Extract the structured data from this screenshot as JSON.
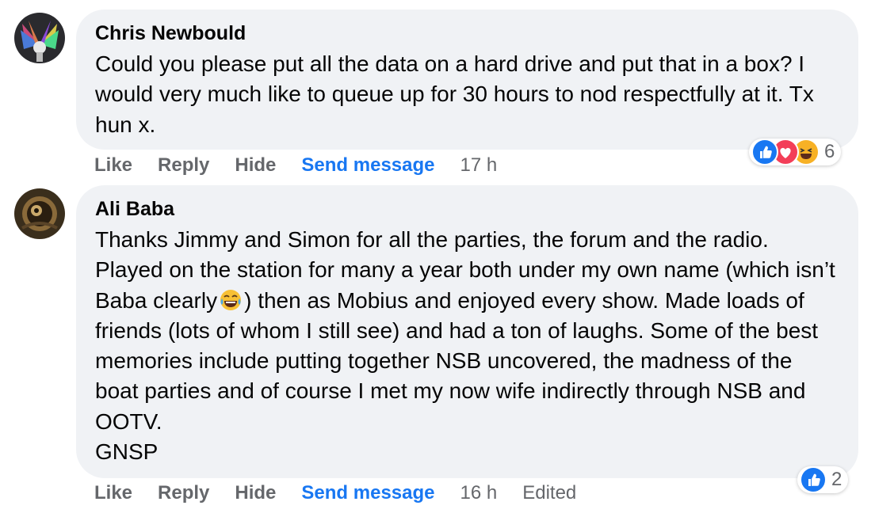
{
  "comments": [
    {
      "author": "Chris Newbould",
      "text": "Could you please put all the data on a hard drive and put that in a box? I would very much like to queue up for 30 hours to nod respectfully at it. Tx hun x.",
      "actions": {
        "like": "Like",
        "reply": "Reply",
        "hide": "Hide",
        "send_message": "Send message",
        "time": "17 h"
      },
      "reactions": {
        "icons": [
          "like-icon",
          "love-icon",
          "haha-icon"
        ],
        "count": "6"
      }
    },
    {
      "author": "Ali Baba",
      "text_before_emoji": "Thanks Jimmy and Simon for all the parties, the forum and the radio. Played on the station for many a year both under my own name (which isn’t Baba clearly",
      "emoji": "tears-of-joy-emoji",
      "text_after_emoji": ") then as Mobius and enjoyed every show. Made loads of friends (lots of whom I still see) and had a ton of laughs. Some of the best memories include putting together NSB uncovered, the madness of the boat parties and of course I met my now wife indirectly through NSB and OOTV.",
      "signoff": "GNSP",
      "actions": {
        "like": "Like",
        "reply": "Reply",
        "hide": "Hide",
        "send_message": "Send message",
        "time": "16 h",
        "edited": "Edited"
      },
      "reactions": {
        "icons": [
          "like-icon"
        ],
        "count": "2"
      }
    }
  ],
  "colors": {
    "bubble": "#f0f2f5",
    "link_blue": "#1877f2",
    "meta_gray": "#65676b",
    "like_blue": "#1877f2",
    "love_red": "#f33e58",
    "haha_yellow": "#f7b125"
  }
}
